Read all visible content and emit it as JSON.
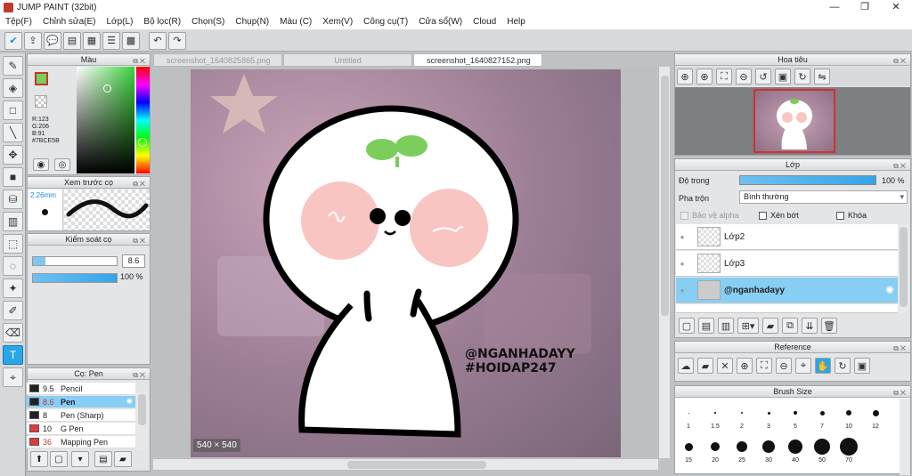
{
  "window": {
    "title": "JUMP PAINT (32bit)",
    "minimize": "—",
    "maximize": "❐",
    "close": "✕"
  },
  "menu": [
    "Tệp(F)",
    "Chỉnh sửa(E)",
    "Lớp(L)",
    "Bộ lọc(R)",
    "Chọn(S)",
    "Chụp(N)",
    "Màu (C)",
    "Xem(V)",
    "Công cụ(T)",
    "Cửa sổ(W)",
    "Cloud",
    "Help"
  ],
  "panels": {
    "color": "Màu",
    "preview": "Xem trước cọ",
    "control": "Kiểm soát cọ",
    "brush": "Cọ: Pen",
    "navigator": "Hoa tiêu",
    "layer": "Lớp",
    "reference": "Reference",
    "brushsize": "Brush Size"
  },
  "color": {
    "r": "R:123",
    "g": "G:206",
    "b": "B:91",
    "hex": "#7BCE5B",
    "fg": "#7BCE5B"
  },
  "preview": {
    "size": "2.26mm"
  },
  "control": {
    "size": "8.6",
    "opacity": "100 %"
  },
  "brushes": [
    {
      "size": "9.5",
      "name": "Pencil",
      "color": "#222222"
    },
    {
      "size": "8.6",
      "name": "Pen",
      "color": "#222222"
    },
    {
      "size": "8",
      "name": "Pen (Sharp)",
      "color": "#222222"
    },
    {
      "size": "10",
      "name": "G Pen",
      "color": "#e53935"
    },
    {
      "size": "36",
      "name": "Mapping Pen",
      "color": "#e53935"
    }
  ],
  "tabs": [
    "screenshot_1640825865.png",
    "Untitled",
    "screenshot_1640827152.png"
  ],
  "canvas": {
    "watermark1": "@NGANHADAYY",
    "watermark2": "#HOIDAP247",
    "dims": "540 × 540"
  },
  "layer": {
    "opacity_label": "Độ trong",
    "opacity_value": "100 %",
    "blend_label": "Pha trộn",
    "blend_value": "Bình thường",
    "protect": "Bảo vệ alpha",
    "clip": "Xén bớt",
    "lock": "Khóa",
    "layers": [
      "Lớp2",
      "Lớp3",
      "@nganhadayy"
    ]
  },
  "brushsizes": [
    "1",
    "1.5",
    "2",
    "3",
    "5",
    "7",
    "10",
    "12",
    "15",
    "20",
    "25",
    "30",
    "40",
    "50",
    "70"
  ]
}
